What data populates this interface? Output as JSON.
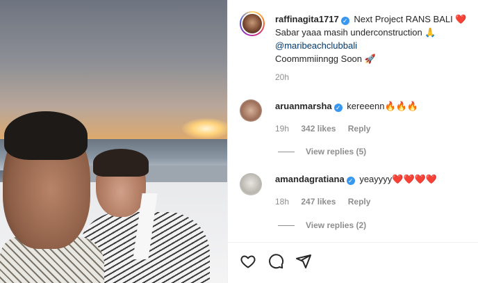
{
  "post": {
    "username": "raffinagita1717",
    "caption_line1": "Next Project RANS BALI",
    "caption_heart": "❤️",
    "caption_line2": "Sabar yaaa masih underconstruction 🙏",
    "mention": "@maribeachclubbali",
    "caption_line4": "Coommmiinngg Soon 🚀",
    "time": "20h"
  },
  "comments": [
    {
      "username": "aruanmarsha",
      "text": "kereeenn🔥🔥🔥",
      "time": "19h",
      "likes": "342 likes",
      "reply": "Reply",
      "view_replies": "View replies (5)"
    },
    {
      "username": "amandagratiana",
      "text": "yeayyyy❤️❤️❤️❤️",
      "time": "18h",
      "likes": "247 likes",
      "reply": "Reply",
      "view_replies": "View replies (2)"
    }
  ],
  "actions": {
    "icons": [
      "heart-icon",
      "comment-icon",
      "share-icon"
    ]
  },
  "colors": {
    "verified": "#3897f0",
    "link": "#00376b",
    "muted": "#8e8e8e"
  }
}
